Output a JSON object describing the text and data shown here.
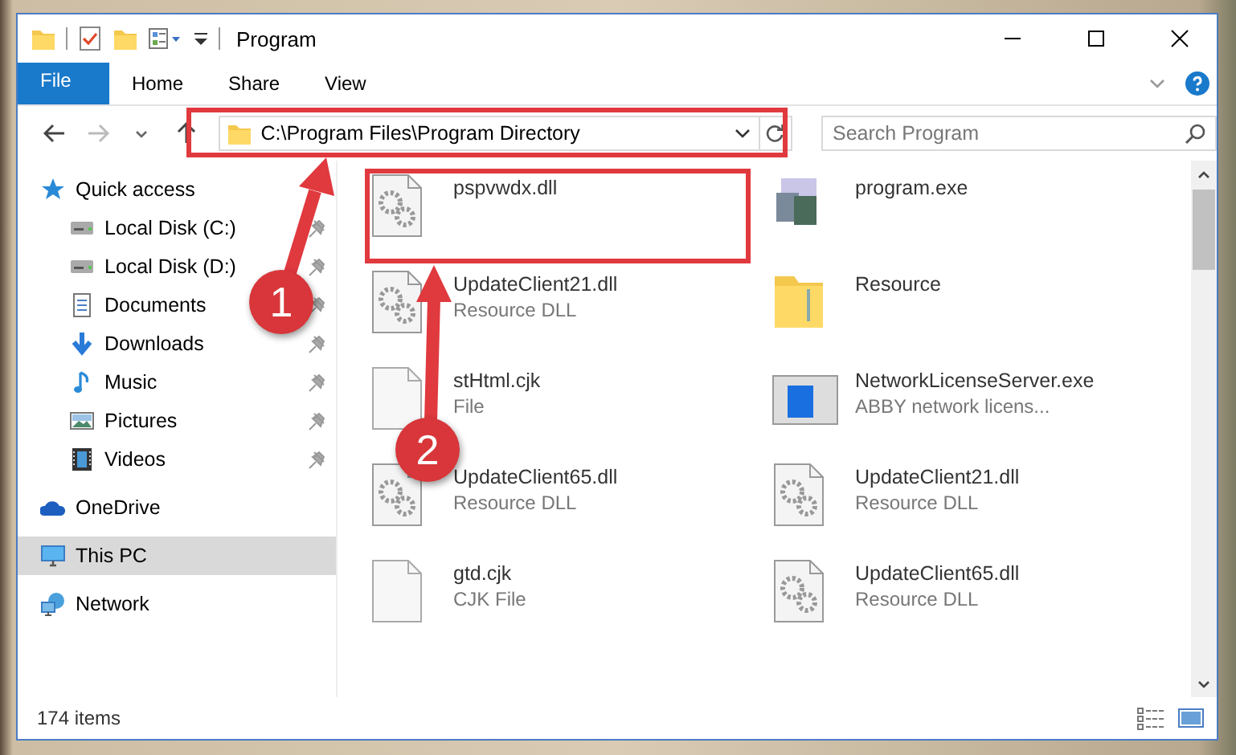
{
  "window": {
    "title": "Program"
  },
  "ribbon_tabs": [
    {
      "label": "File",
      "kind": "file"
    },
    {
      "label": "Home",
      "kind": "tab"
    },
    {
      "label": "Share",
      "kind": "tab"
    },
    {
      "label": "View",
      "kind": "tab"
    }
  ],
  "address_bar": {
    "path": "C:\\Program Files\\Program Directory"
  },
  "search": {
    "placeholder": "Search Program"
  },
  "sidebar": {
    "items": [
      {
        "label": "Quick access",
        "kind": "star",
        "selected": false,
        "pinned": false,
        "children": [
          {
            "label": "Local Disk (C:)",
            "kind": "drive",
            "selected": false,
            "pinned": true
          },
          {
            "label": "Local Disk (D:)",
            "kind": "drive",
            "selected": false,
            "pinned": true
          },
          {
            "label": "Documents",
            "kind": "document",
            "selected": false,
            "pinned": true
          },
          {
            "label": "Downloads",
            "kind": "download",
            "selected": false,
            "pinned": true
          },
          {
            "label": "Music",
            "kind": "music",
            "selected": false,
            "pinned": true
          },
          {
            "label": "Pictures",
            "kind": "pictures",
            "selected": false,
            "pinned": true
          },
          {
            "label": "Videos",
            "kind": "video",
            "selected": false,
            "pinned": true
          }
        ]
      },
      {
        "label": "OneDrive",
        "kind": "cloud",
        "selected": false,
        "pinned": false
      },
      {
        "label": "This PC",
        "kind": "monitor",
        "selected": true,
        "pinned": false
      },
      {
        "label": "Network",
        "kind": "network",
        "selected": false,
        "pinned": false
      }
    ]
  },
  "files": [
    {
      "name": "pspvwdx.dll",
      "kind": "gear"
    },
    {
      "name": "program.exe",
      "kind": "exe"
    },
    {
      "name": "UpdateClient21.dll",
      "type": "Resource DLL",
      "kind": "gear"
    },
    {
      "name": "Resource",
      "kind": "folder"
    },
    {
      "name": "stHtml.cjk",
      "type": "File",
      "kind": "blank"
    },
    {
      "name": "NetworkLicenseServer.exe",
      "type": "ABBY network licens...",
      "kind": "app"
    },
    {
      "name": "UpdateClient65.dll",
      "type": "Resource DLL",
      "kind": "gear"
    },
    {
      "name": "UpdateClient21.dll",
      "type": "Resource DLL",
      "kind": "gear"
    },
    {
      "name": "gtd.cjk",
      "type": "CJK File",
      "kind": "blank"
    },
    {
      "name": "UpdateClient65.dll",
      "type": "Resource DLL",
      "kind": "gear"
    }
  ],
  "status_bar": {
    "item_count": "174 items"
  },
  "annotations": [
    {
      "label": "1"
    },
    {
      "label": "2"
    }
  ]
}
